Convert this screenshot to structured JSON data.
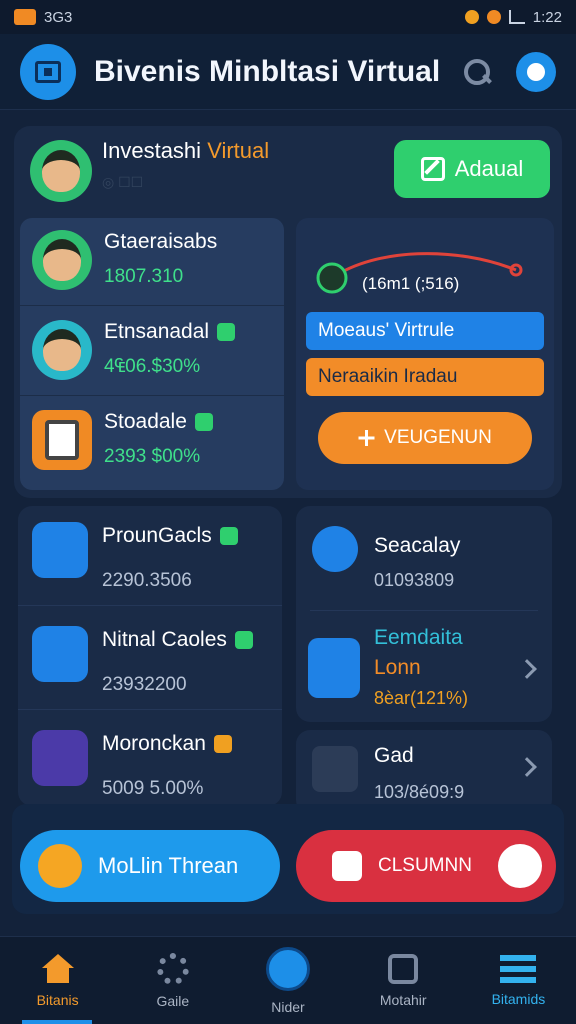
{
  "status_bar": {
    "left_text": "3G3",
    "time": "1:22"
  },
  "header": {
    "title": "Bivenis Minbltasi Virtual"
  },
  "hero": {
    "title_main": "Investashi",
    "title_accent": "Virtual",
    "subtitle": "◎ ☐☐",
    "action_label": "Adaual"
  },
  "left_list": [
    {
      "name": "Gtaeraisabs",
      "value": "1807.310"
    },
    {
      "name": "Etnsanadal",
      "value": "4₠06.$30%"
    },
    {
      "name": "Stoadale",
      "value": "2393 $00%"
    }
  ],
  "right_panel": {
    "curve_label": "(16m1 (;516)",
    "blue_bar": "Moeaus' Virtrule",
    "orange_bar": "Neraaikin Iradau",
    "pill_label": "VEUGENUN"
  },
  "lower_left": [
    {
      "name": "ProunGacls",
      "value": "2290.3506"
    },
    {
      "name": "Nitnal Caoles",
      "value": "23932200"
    },
    {
      "name": "Moronckan",
      "value": "5009 5.00%"
    }
  ],
  "lower_right": {
    "first": {
      "name": "Seacalay",
      "value": "01093809"
    },
    "second": {
      "name_line1": "Eemdaita",
      "name_line2": "Lonn",
      "value": "8èar(121%)"
    },
    "third": {
      "name": "Gad",
      "value": "103/8é09:9"
    }
  },
  "actions": {
    "blue": "MoLlin Threan",
    "red": "CLSUMNN"
  },
  "nav": [
    {
      "label": "Bitanis"
    },
    {
      "label": "Gaile"
    },
    {
      "label": "Nider"
    },
    {
      "label": "Motahir"
    },
    {
      "label": "Bitamids"
    }
  ]
}
